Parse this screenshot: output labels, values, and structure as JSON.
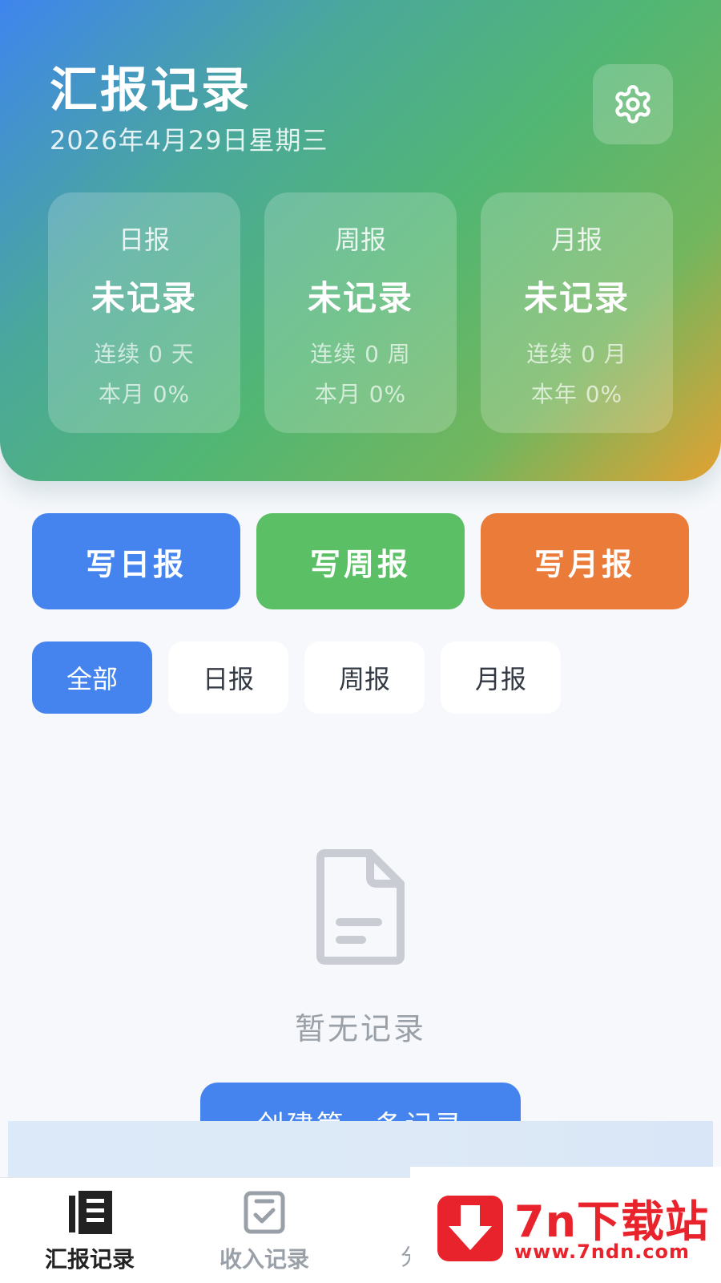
{
  "header": {
    "title": "汇报记录",
    "date": "2026年4月29日星期三"
  },
  "stat_cards": [
    {
      "label": "日报",
      "status": "未记录",
      "streak": "连续 0 天",
      "rate": "本月 0%"
    },
    {
      "label": "周报",
      "status": "未记录",
      "streak": "连续 0 周",
      "rate": "本月 0%"
    },
    {
      "label": "月报",
      "status": "未记录",
      "streak": "连续 0 月",
      "rate": "本年 0%"
    }
  ],
  "write_buttons": {
    "daily": "写日报",
    "weekly": "写周报",
    "monthly": "写月报"
  },
  "filters": [
    "全部",
    "日报",
    "周报",
    "月报"
  ],
  "filter_active_index": 0,
  "empty_state": {
    "text": "暂无记录",
    "create_button": "创建第一条记录",
    "icon": "document-icon"
  },
  "bottom_nav": [
    {
      "label": "汇报记录",
      "icon": "report-list-icon",
      "active": true
    },
    {
      "label": "收入记录",
      "icon": "income-check-icon",
      "active": false
    }
  ],
  "bottom_nav_third_partial": "分",
  "watermark": {
    "name": "7n下载站",
    "url": "www.7ndn.com"
  },
  "colors": {
    "daily": "#4584ee",
    "weekly": "#5bbf65",
    "monthly": "#eb7b39",
    "nav_active": "#222222",
    "nav_inactive": "#9aa0a8",
    "watermark": "#e8232b"
  }
}
